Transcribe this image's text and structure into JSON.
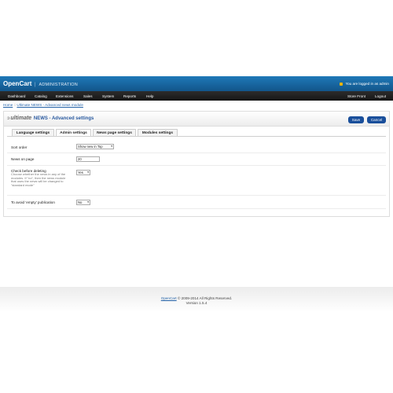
{
  "header": {
    "brand": "OpenCart",
    "separator": "|",
    "subtitle": "ADMINISTRATION",
    "logged_in": "You are logged in as admin"
  },
  "menu": {
    "items": [
      "Dashboard",
      "Catalog",
      "Extensions",
      "Sales",
      "System",
      "Reports",
      "Help"
    ],
    "right_items": [
      "Store Front",
      "Logout"
    ]
  },
  "breadcrumb": {
    "home": "Home",
    "divider": "::",
    "current": "Ultimate NEWS - Advanced news module"
  },
  "panel": {
    "brand_symbol": "ↄ",
    "brand_name": "ultimate",
    "title": "NEWS - Advanced settings",
    "save_label": "Save",
    "cancel_label": "Cancel"
  },
  "tabs": [
    "Language settings",
    "Admin settings",
    "News page settings",
    "Modules settings"
  ],
  "form": {
    "sort_order": {
      "label": "Sort order",
      "value": "Show new in Top"
    },
    "news_on_page": {
      "label": "News on page",
      "value": "20"
    },
    "check_deleting": {
      "label": "Check before deleting",
      "help": "Choose whether the news in any of the modules. If \"no\", then the news module that uses the news will be changed to \"standard mode\"",
      "value": "Yes"
    },
    "avoid_empty": {
      "label": "To avoid 'empty' publication",
      "value": "No"
    }
  },
  "footer": {
    "link": "OpenCart",
    "copyright": "© 2009-2014 All Rights Reserved.",
    "version": "Version 1.5.4"
  },
  "colors": {
    "header_blue": "#1a66a3",
    "menu_black": "#1e1e1e",
    "button_blue": "#1a4f9b",
    "link_blue": "#2563a8",
    "lock_yellow": "#f0b400"
  },
  "icons": [
    "lock-icon",
    "ultimate-logo-icon",
    "dropdown-arrow-icon"
  ]
}
